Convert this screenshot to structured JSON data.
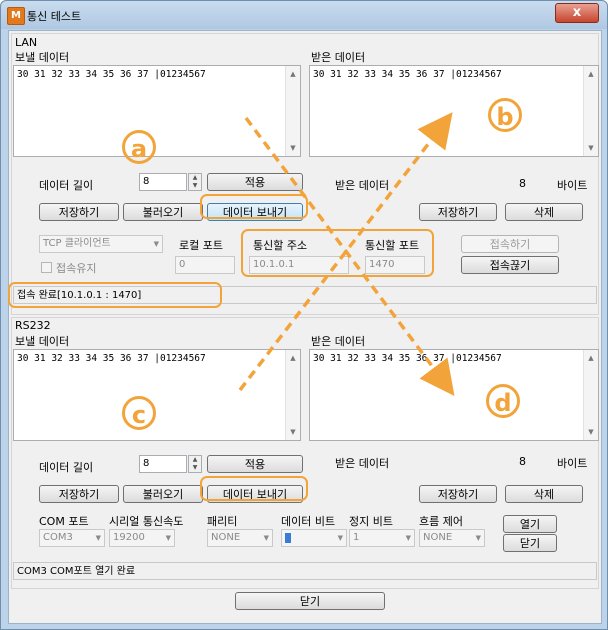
{
  "window": {
    "title": "통신 테스트",
    "app_icon_text": "M",
    "close_glyph": "x"
  },
  "lan": {
    "group_label": "LAN",
    "send_label": "보낼 데이터",
    "recv_label": "받은 데이터",
    "send_text": "30 31 32 33 34 35 36 37 |01234567",
    "recv_text": "30 31 32 33 34 35 36 37 |01234567",
    "length_label": "데이터 길이",
    "length_value": "8",
    "apply_label": "적용",
    "recv_count_label": "받은 데이터",
    "recv_count_value": "8",
    "recv_count_unit": "바이트",
    "save_label": "저장하기",
    "load_label": "불러오기",
    "send_button": "데이터 보내기",
    "save2_label": "저장하기",
    "delete_label": "삭제",
    "mode_value": "TCP 클라이언트",
    "keep_alive_label": "접속유지",
    "local_port_label": "로컬 포트",
    "local_port_value": "0",
    "remote_addr_label": "통신할 주소",
    "remote_addr_value": "10.1.0.1",
    "remote_port_label": "통신할 포트",
    "remote_port_value": "1470",
    "connect_label": "접속하기",
    "disconnect_label": "접속끊기",
    "status_text": "접속 완료[10.1.0.1 : 1470]"
  },
  "rs232": {
    "group_label": "RS232",
    "send_label": "보낼 데이터",
    "recv_label": "받은 데이터",
    "send_text": "30 31 32 33 34 35 36 37 |01234567",
    "recv_text": "30 31 32 33 34 35 36 37 |01234567",
    "length_label": "데이터 길이",
    "length_value": "8",
    "apply_label": "적용",
    "recv_count_label": "받은 데이터",
    "recv_count_value": "8",
    "recv_count_unit": "바이트",
    "save_label": "저장하기",
    "load_label": "불러오기",
    "send_button": "데이터 보내기",
    "save2_label": "저장하기",
    "delete_label": "삭제",
    "com_port_label": "COM 포트",
    "baud_label": "시리얼 통신속도",
    "parity_label": "패리티",
    "data_bits_label": "데이터 비트",
    "stop_bits_label": "정지 비트",
    "flow_label": "흐름 제어",
    "com_port_value": "COM3",
    "baud_value": "19200",
    "parity_value": "NONE",
    "data_bits_value": "",
    "stop_bits_value": "1",
    "flow_value": "NONE",
    "open_label": "열기",
    "close_label": "닫기",
    "status_text": "COM3 COM포트 열기 완료"
  },
  "footer": {
    "close_label": "닫기"
  },
  "annotations": {
    "a": "a",
    "b": "b",
    "c": "c",
    "d": "d"
  },
  "colors": {
    "annotation": "#f2a43a",
    "title_bar": "#bcd3ea",
    "close_button": "#c7452d"
  }
}
